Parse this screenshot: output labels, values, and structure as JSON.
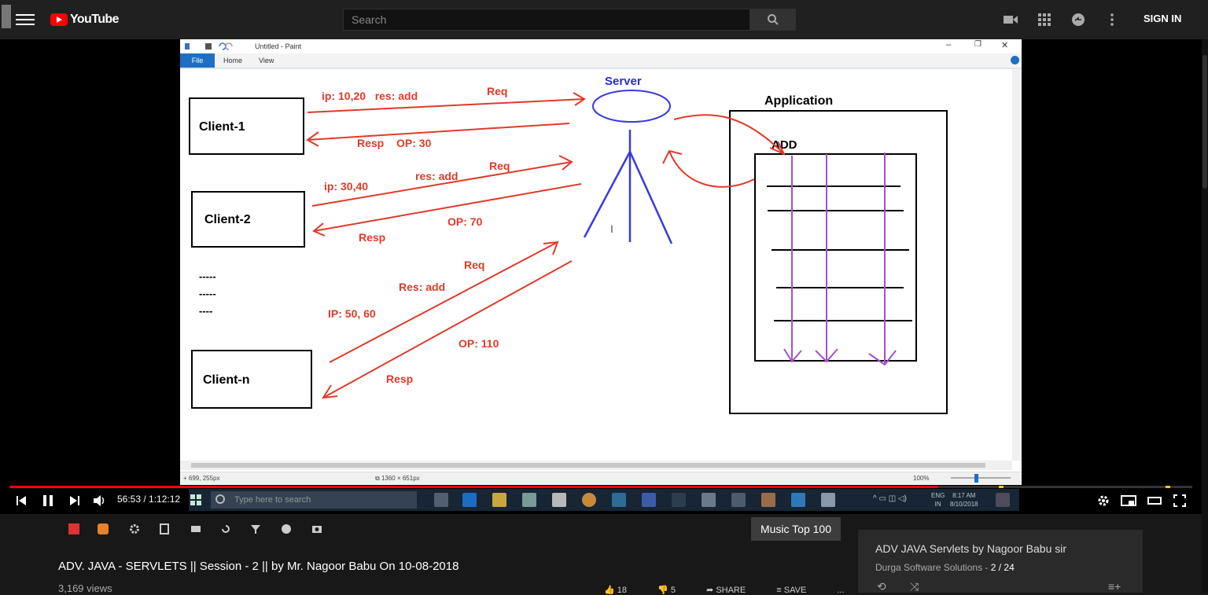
{
  "header": {
    "logo_text": "YouTube",
    "search_placeholder": "Search",
    "sign_in": "SIGN IN"
  },
  "paint": {
    "window_title": "Untitled - Paint",
    "ribbon": [
      "File",
      "Home",
      "View"
    ],
    "status_cursor": "699, 255px",
    "status_size": "1360 × 651px",
    "zoom": "100%"
  },
  "drawing": {
    "clients": [
      "Client-1",
      "Client-2",
      "Client-n"
    ],
    "dashes": [
      "-----",
      "-----",
      "----"
    ],
    "server_label": "Server",
    "application_label": "Application",
    "add_label": "ADD",
    "req_labels": [
      "Req",
      "Req",
      "Req"
    ],
    "resp_labels": [
      "Resp",
      "Resp",
      "Resp"
    ],
    "c1_request": "ip: 10,20   res: add",
    "c1_op": "OP: 30",
    "c2_ip": "ip: 30,40",
    "c2_res": "res: add",
    "c2_op": "OP: 70",
    "cn_ip": "IP: 50, 60",
    "cn_res": "Res: add",
    "cn_op": "OP: 110"
  },
  "player": {
    "time": "56:53 / 1:12:12",
    "progress_fraction": 0.785
  },
  "taskbar": {
    "search_placeholder": "Type here to search",
    "lang": "ENG",
    "region": "IN",
    "time": "8:17 AM",
    "date": "8/10/2018"
  },
  "video": {
    "title": "ADV. JAVA - SERVLETS || Session - 2 || by Mr. Nagoor Babu On 10-08-2018",
    "views": "3,169 views",
    "likes": "18",
    "dislikes": "5",
    "share": "SHARE",
    "save": "SAVE",
    "more": "..."
  },
  "music_badge": "Music Top 100",
  "playlist": {
    "title": "ADV JAVA Servlets by Nagoor Babu sir",
    "channel": "Durga Software Solutions",
    "position": "2 / 24"
  }
}
